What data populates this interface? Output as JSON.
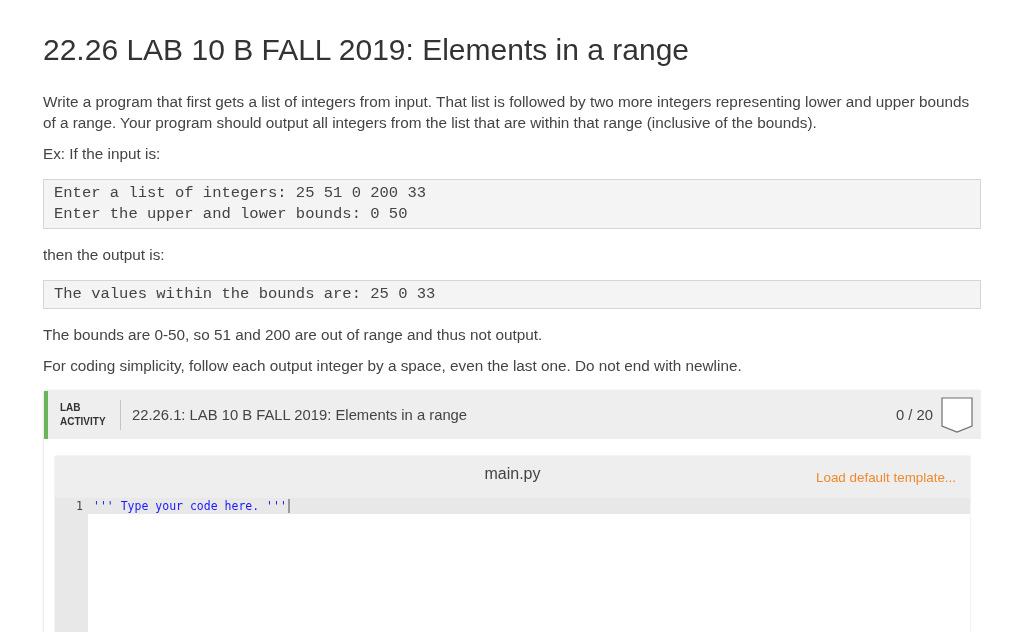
{
  "title": "22.26 LAB 10 B FALL 2019: Elements in a range",
  "content": [
    {
      "kind": "paragraph",
      "text": "Write a program that first gets a list of integers from input. That list is followed by two more integers representing lower and upper bounds of a range. Your program should output all integers from the list that are within that range (inclusive of the bounds)."
    },
    {
      "kind": "paragraph",
      "text": "Ex: If the input is:"
    },
    {
      "kind": "code",
      "lines": [
        "Enter a list of integers: 25 51 0 200 33",
        "Enter the upper and lower bounds: 0 50"
      ]
    },
    {
      "kind": "paragraph",
      "text": "then the output is:"
    },
    {
      "kind": "code",
      "lines": [
        "The values within the bounds are: 25 0 33"
      ]
    },
    {
      "kind": "paragraph",
      "text": "The bounds are 0-50, so 51 and 200 are out of range and thus not output."
    },
    {
      "kind": "paragraph",
      "text": "For coding simplicity, follow each output integer by a space, even the last one. Do not end with newline."
    }
  ],
  "lab_activity": {
    "label_lines": [
      "LAB",
      "ACTIVITY"
    ],
    "title": "22.26.1: LAB 10 B FALL 2019: Elements in a range",
    "score": "0 / 20",
    "completed": false
  },
  "editor": {
    "filename": "main.py",
    "template_link": "Load default template...",
    "lines": [
      {
        "number": "1",
        "code": "''' Type your code here. '''",
        "active": true
      }
    ]
  }
}
